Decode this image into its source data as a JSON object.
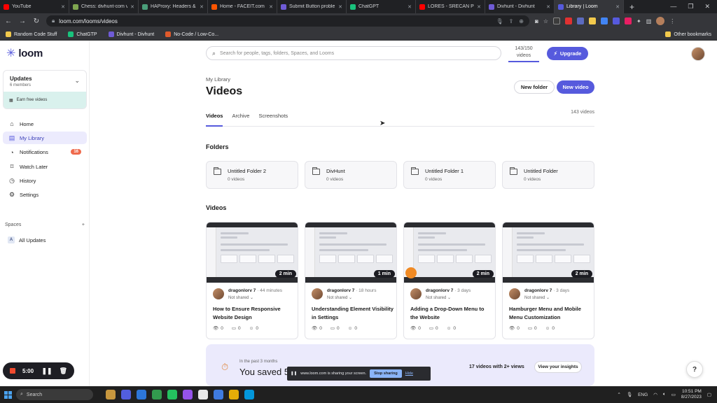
{
  "browser": {
    "tabs": [
      {
        "label": "YouTube",
        "color": "#ff0000",
        "active": false
      },
      {
        "label": "Chess: divhunt-com v",
        "color": "#7fa650",
        "active": false
      },
      {
        "label": "HAProxy: Headers & C",
        "color": "#4a9e7a",
        "active": false
      },
      {
        "label": "Home - FACEIT.com",
        "color": "#ff5500",
        "active": false
      },
      {
        "label": "Submit Button proble",
        "color": "#6f5bd6",
        "active": false
      },
      {
        "label": "ChatGPT",
        "color": "#19c37d",
        "active": false
      },
      {
        "label": "LORES - SRECAN PUT",
        "color": "#ff0000",
        "active": false
      },
      {
        "label": "Divhunt - Divhunt",
        "color": "#6f5bd6",
        "active": false
      },
      {
        "label": "Library | Loom",
        "color": "#565add",
        "active": true
      }
    ],
    "url": "loom.com/looms/videos",
    "bookmarks": [
      {
        "label": "Random Code Stuff",
        "color": "#f2c94c"
      },
      {
        "label": "ChatGTP",
        "color": "#19c37d"
      },
      {
        "label": "Divhunt - Divhunt",
        "color": "#6f5bd6"
      },
      {
        "label": "No-Code / Low-Co...",
        "color": "#e05a2b"
      }
    ],
    "other_bookmarks": "Other bookmarks"
  },
  "sidebar": {
    "logo": "loom",
    "workspace": {
      "title": "Updates",
      "members": "6 members",
      "earn": "Earn free videos"
    },
    "nav": [
      {
        "label": "Home",
        "icon": "home-icon",
        "glyph": "⌂",
        "active": false,
        "badge": ""
      },
      {
        "label": "My Library",
        "icon": "library-icon",
        "glyph": "▤",
        "active": true,
        "badge": ""
      },
      {
        "label": "Notifications",
        "icon": "bell-icon",
        "glyph": "◔",
        "active": false,
        "badge": "16"
      },
      {
        "label": "Watch Later",
        "icon": "bookmark-icon",
        "glyph": "⌑",
        "active": false,
        "badge": ""
      },
      {
        "label": "History",
        "icon": "history-icon",
        "glyph": "◷",
        "active": false,
        "badge": ""
      },
      {
        "label": "Settings",
        "icon": "gear-icon",
        "glyph": "⚙",
        "active": false,
        "badge": ""
      }
    ],
    "spaces_heading": "Spaces",
    "space_item": {
      "avatar": "A",
      "label": "All Updates"
    },
    "recorder": {
      "time": "5:00"
    }
  },
  "header": {
    "search_placeholder": "Search for people, tags, folders, Spaces, and Looms",
    "quota_top": "143/150",
    "quota_bottom": "videos",
    "upgrade": "Upgrade"
  },
  "page": {
    "breadcrumb": "My Library",
    "title": "Videos",
    "new_folder": "New folder",
    "new_video": "New video",
    "tabs": [
      {
        "label": "Videos",
        "active": true
      },
      {
        "label": "Archive",
        "active": false
      },
      {
        "label": "Screenshots",
        "active": false
      }
    ],
    "count": "143 videos"
  },
  "folders_heading": "Folders",
  "folders": [
    {
      "name": "Untitled Folder 2",
      "count": "0 videos"
    },
    {
      "name": "DivHunt",
      "count": "0 videos"
    },
    {
      "name": "Untitled Folder 1",
      "count": "0 videos"
    },
    {
      "name": "Untitled Folder",
      "count": "0 videos"
    }
  ],
  "videos_heading": "Videos",
  "videos": [
    {
      "duration": "2 min",
      "author": "dragonlorv 7",
      "age": "· 44 minutes",
      "sharing": "Not shared",
      "title": "How to Ensure Responsive Website Design",
      "views": "0",
      "comments": "0",
      "reactions": "0"
    },
    {
      "duration": "1 min",
      "author": "dragonlorv 7",
      "age": "· 18 hours",
      "sharing": "Not shared",
      "title": "Understanding Element Visibility in Settings",
      "views": "0",
      "comments": "0",
      "reactions": "0"
    },
    {
      "duration": "2 min",
      "author": "dragonlorv 7",
      "age": "· 3 days",
      "sharing": "Not shared",
      "title": "Adding a Drop-Down Menu to the Website",
      "views": "0",
      "comments": "0",
      "reactions": "0"
    },
    {
      "duration": "2 min",
      "author": "dragonlorv 7",
      "age": "· 3 days",
      "sharing": "Not shared",
      "title": "Hamburger Menu and Mobile Menu Customization",
      "views": "0",
      "comments": "0",
      "reactions": "0"
    }
  ],
  "insights": {
    "period": "In the past 3 months",
    "saved": "You saved 5",
    "views_count": "17 videos with 2+ views",
    "button": "View your insights"
  },
  "share_bar": {
    "text": "www.loom.com is sharing your screen.",
    "stop": "Stop sharing",
    "hide": "Hide"
  },
  "taskbar": {
    "search": "Search",
    "lang": "ENG",
    "time": "10:51 PM",
    "date": "8/27/2023",
    "apps": [
      "#d9a441",
      "#5865f2",
      "#2f80ed",
      "#34a853",
      "#25d366",
      "#a259ff",
      "#ffffff",
      "#4285f4",
      "#fbbc05",
      "#00a4ef"
    ]
  }
}
